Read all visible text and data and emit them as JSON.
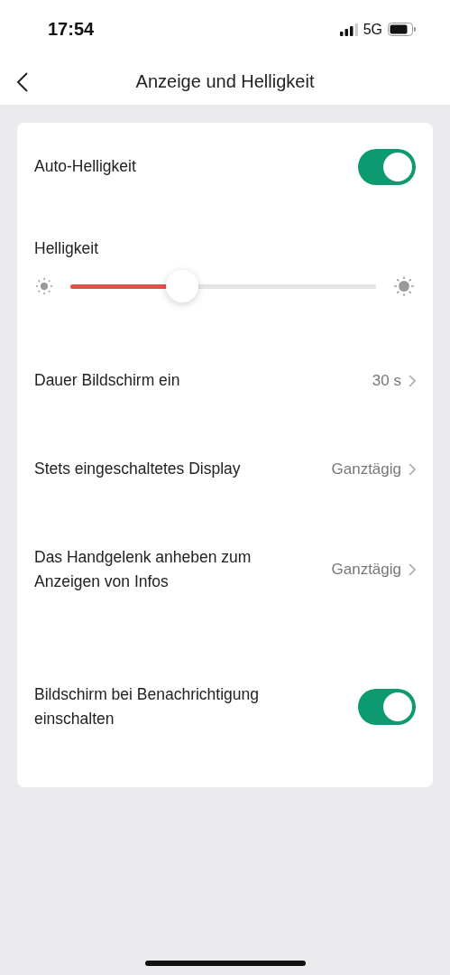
{
  "status_bar": {
    "time": "17:54",
    "network": "5G"
  },
  "header": {
    "title": "Anzeige und Helligkeit"
  },
  "settings": [
    {
      "kind": "toggle",
      "label": "Auto-Helligkeit",
      "on": true
    },
    {
      "kind": "slider",
      "label": "Helligkeit",
      "level": 0.365
    },
    {
      "kind": "nav",
      "label": "Dauer Bildschirm ein",
      "value": "30 s"
    },
    {
      "kind": "nav",
      "label": "Stets eingeschaltetes Display",
      "value": "Ganztägig"
    },
    {
      "kind": "nav",
      "label": "Das Handgelenk anheben zum Anzeigen von Infos",
      "value": "Ganztägig"
    },
    {
      "kind": "toggle",
      "label": "Bildschirm bei Benachrichtigung einschalten",
      "on": true
    }
  ]
}
